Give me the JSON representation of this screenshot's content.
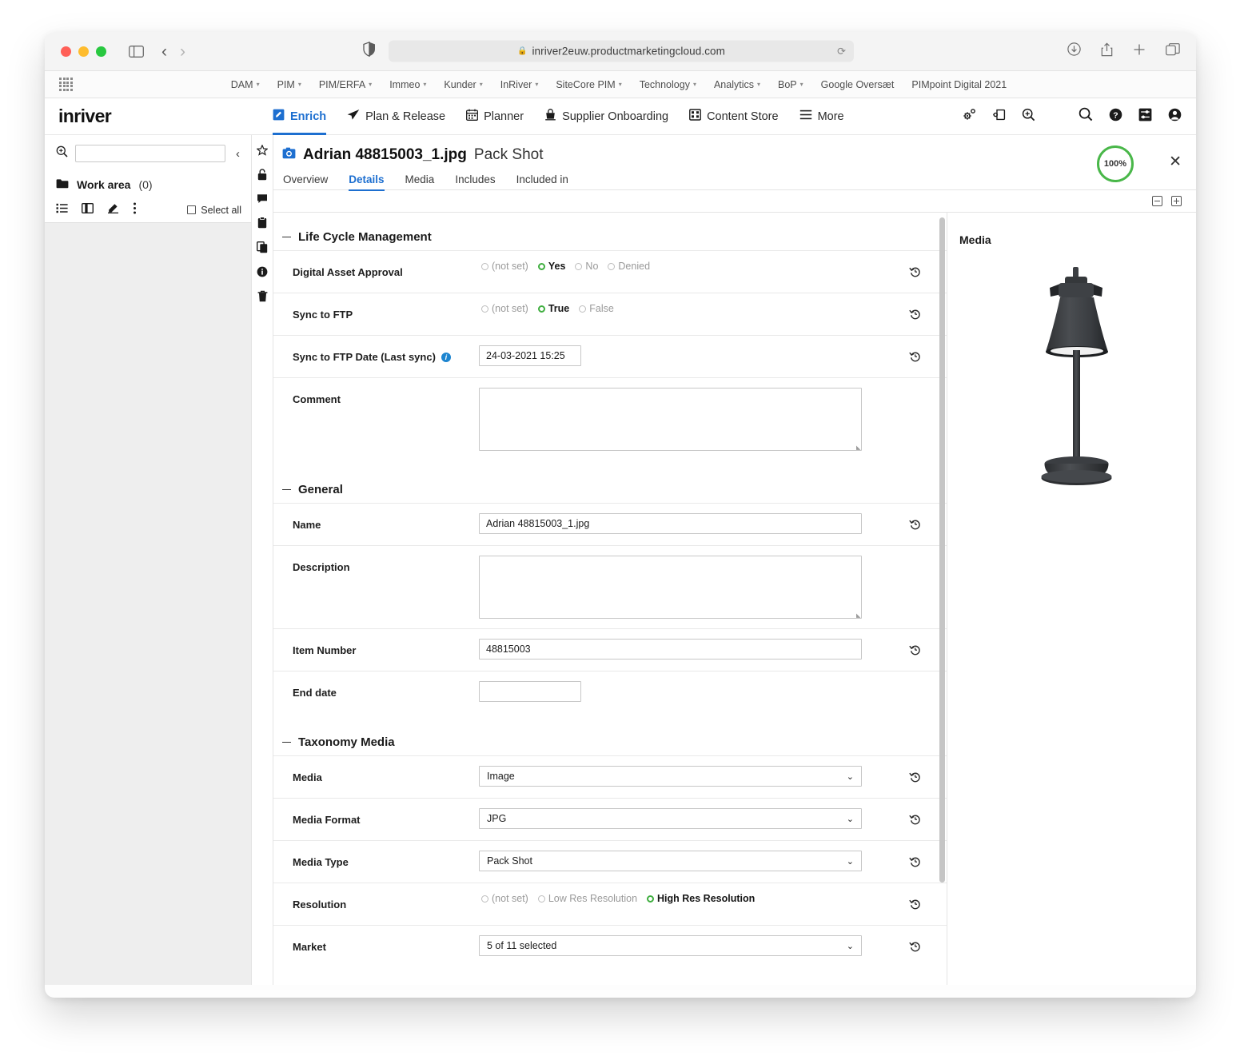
{
  "browser": {
    "url": "inriver2euw.productmarketingcloud.com",
    "lock_icon": "lock-icon",
    "reload_icon": "reload-icon",
    "back_icon": "back-arrow-icon",
    "forward_icon": "forward-arrow-icon",
    "sidebar_icon": "sidebar-toggle-icon",
    "shield_icon": "privacy-shield-icon",
    "right_icons": [
      "download-icon",
      "share-icon",
      "new-tab-icon",
      "tab-overview-icon"
    ]
  },
  "bookmarks": {
    "apps_icon": "apps-grid-icon",
    "items": [
      {
        "label": "DAM",
        "has_menu": true
      },
      {
        "label": "PIM",
        "has_menu": true
      },
      {
        "label": "PIM/ERFA",
        "has_menu": true
      },
      {
        "label": "Immeo",
        "has_menu": true
      },
      {
        "label": "Kunder",
        "has_menu": true
      },
      {
        "label": "InRiver",
        "has_menu": true
      },
      {
        "label": "SiteCore PIM",
        "has_menu": true
      },
      {
        "label": "Technology",
        "has_menu": true
      },
      {
        "label": "Analytics",
        "has_menu": true
      },
      {
        "label": "BoP",
        "has_menu": true
      },
      {
        "label": "Google Oversæt",
        "has_menu": false
      },
      {
        "label": "PIMpoint Digital 2021",
        "has_menu": false
      }
    ]
  },
  "app_header": {
    "logo": "inriver",
    "nav": [
      {
        "label": "Enrich",
        "icon": "enrich-edit-icon",
        "active": true
      },
      {
        "label": "Plan & Release",
        "icon": "paper-plane-icon",
        "active": false
      },
      {
        "label": "Planner",
        "icon": "calendar-icon",
        "active": false
      },
      {
        "label": "Supplier Onboarding",
        "icon": "supplier-icon",
        "active": false
      },
      {
        "label": "Content Store",
        "icon": "store-icon",
        "active": false
      },
      {
        "label": "More",
        "icon": "hamburger-icon",
        "active": false
      }
    ],
    "right_icons": [
      "settings-gear-icon",
      "export-icon",
      "zoom-in-icon",
      "search-icon",
      "help-icon",
      "tasks-icon",
      "user-avatar-icon"
    ],
    "accent_color": "#1d6fd0"
  },
  "sidebar": {
    "search_placeholder": "",
    "search_value": "",
    "search_icon": "search-zoom-icon",
    "collapse_icon": "chevron-left-icon",
    "work_area_label": "Work area",
    "work_area_count": "(0)",
    "folder_icon": "folder-icon",
    "tools": [
      "list-view-icon",
      "split-view-icon",
      "highlighter-icon",
      "more-vertical-icon"
    ],
    "select_all_label": "Select all"
  },
  "icon_rail": {
    "items": [
      "star-icon",
      "lock-icon",
      "comment-icon",
      "clipboard-icon",
      "copy-icon",
      "info-icon",
      "trash-icon"
    ]
  },
  "entity": {
    "icon": "camera-asset-icon",
    "name": "Adrian 48815003_1.jpg",
    "type": "Pack Shot",
    "completeness": "100%",
    "completeness_color": "#49b749",
    "close_icon": "close-icon",
    "tabs": [
      {
        "label": "Overview",
        "active": false
      },
      {
        "label": "Details",
        "active": true
      },
      {
        "label": "Media",
        "active": false
      },
      {
        "label": "Includes",
        "active": false
      },
      {
        "label": "Included in",
        "active": false
      }
    ],
    "tool_icons": [
      "collapse-all-icon",
      "expand-all-icon"
    ]
  },
  "sections": [
    {
      "title": "Life Cycle Management",
      "collapse_icon": "minus-icon",
      "fields": [
        {
          "label": "Digital Asset Approval",
          "type": "radio",
          "history_icon": "revert-history-icon",
          "options": [
            {
              "label": "(not set)",
              "selected": false
            },
            {
              "label": "Yes",
              "selected": true
            },
            {
              "label": "No",
              "selected": false
            },
            {
              "label": "Denied",
              "selected": false
            }
          ]
        },
        {
          "label": "Sync to FTP",
          "type": "radio",
          "history_icon": "revert-history-icon",
          "options": [
            {
              "label": "(not set)",
              "selected": false
            },
            {
              "label": "True",
              "selected": true
            },
            {
              "label": "False",
              "selected": false
            }
          ]
        },
        {
          "label": "Sync to FTP Date (Last sync)",
          "type": "text-small",
          "info_icon": "info-icon",
          "value": "24-03-2021 15:25",
          "history_icon": "revert-history-icon"
        },
        {
          "label": "Comment",
          "type": "textarea",
          "value": "",
          "history_icon": ""
        }
      ]
    },
    {
      "title": "General",
      "collapse_icon": "minus-icon",
      "fields": [
        {
          "label": "Name",
          "type": "text",
          "value": "Adrian 48815003_1.jpg",
          "history_icon": "revert-history-icon"
        },
        {
          "label": "Description",
          "type": "textarea",
          "value": "",
          "history_icon": ""
        },
        {
          "label": "Item Number",
          "type": "text",
          "value": "48815003",
          "history_icon": "revert-history-icon"
        },
        {
          "label": "End date",
          "type": "text-small",
          "value": "",
          "history_icon": ""
        }
      ]
    },
    {
      "title": "Taxonomy Media",
      "collapse_icon": "minus-icon",
      "fields": [
        {
          "label": "Media",
          "type": "select",
          "value": "Image",
          "history_icon": "revert-history-icon"
        },
        {
          "label": "Media Format",
          "type": "select",
          "value": "JPG",
          "history_icon": "revert-history-icon"
        },
        {
          "label": "Media Type",
          "type": "select",
          "value": "Pack Shot",
          "history_icon": "revert-history-icon"
        },
        {
          "label": "Resolution",
          "type": "radio",
          "history_icon": "revert-history-icon",
          "options": [
            {
              "label": "(not set)",
              "selected": false
            },
            {
              "label": "Low Res Resolution",
              "selected": false
            },
            {
              "label": "High Res Resolution",
              "selected": true
            }
          ]
        },
        {
          "label": "Market",
          "type": "select",
          "value": "5 of 11 selected",
          "history_icon": "revert-history-icon"
        }
      ]
    }
  ],
  "media_panel": {
    "title": "Media",
    "image_alt": "dark grey desk lamp pack shot"
  }
}
